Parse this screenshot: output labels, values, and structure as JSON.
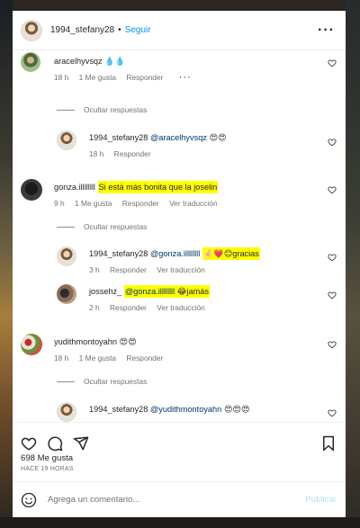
{
  "header": {
    "username": "1994_stefany28",
    "separator": "•",
    "follow_label": "Seguir",
    "more_icon": "more-horizontal-icon"
  },
  "comments": [
    {
      "username": "aracelhyvsqz",
      "text": "💧💧",
      "time": "18 h",
      "likes": "1 Me gusta",
      "reply": "Responder",
      "more": "···",
      "hide_replies": "Ocultar respuestas",
      "replies": [
        {
          "username": "1994_stefany28",
          "mention": "@aracelhyvsqz",
          "text": "😍😍",
          "time": "18 h",
          "reply": "Responder"
        }
      ]
    },
    {
      "username": "gonza.illllllll",
      "text": "Si está más bonita que la joselin",
      "time": "9 h",
      "likes": "1 Me gusta",
      "reply": "Responder",
      "translate": "Ver traducción",
      "hide_replies": "Ocultar respuestas",
      "replies": [
        {
          "username": "1994_stefany28",
          "mention": "@gonza.illllllll",
          "text": "🤞🏻💗😊gracias",
          "time": "3 h",
          "reply": "Responder",
          "translate": "Ver traducción"
        },
        {
          "username": "jossehz_",
          "mention": "@gonza.illllllll",
          "text": "😂jamás",
          "time": "2 h",
          "reply": "Responder",
          "translate": "Ver traducción"
        }
      ]
    },
    {
      "username": "yudithmontoyahn",
      "text": "😍😍",
      "time": "18 h",
      "likes": "1 Me gusta",
      "reply": "Responder",
      "hide_replies": "Ocultar respuestas",
      "replies": [
        {
          "username": "1994_stefany28",
          "mention": "@yudithmontoyahn",
          "text": "😍😍😍"
        }
      ]
    }
  ],
  "post": {
    "likes": "698 Me gusta",
    "time_ago": "HACE 19 HORAS"
  },
  "add_comment": {
    "placeholder": "Agrega un comentario...",
    "publish_label": "Publicar"
  },
  "colors": {
    "link_blue": "#0095f6",
    "publish_disabled": "#b2dffc",
    "meta_gray": "#737373",
    "highlight": "#ffff00"
  }
}
